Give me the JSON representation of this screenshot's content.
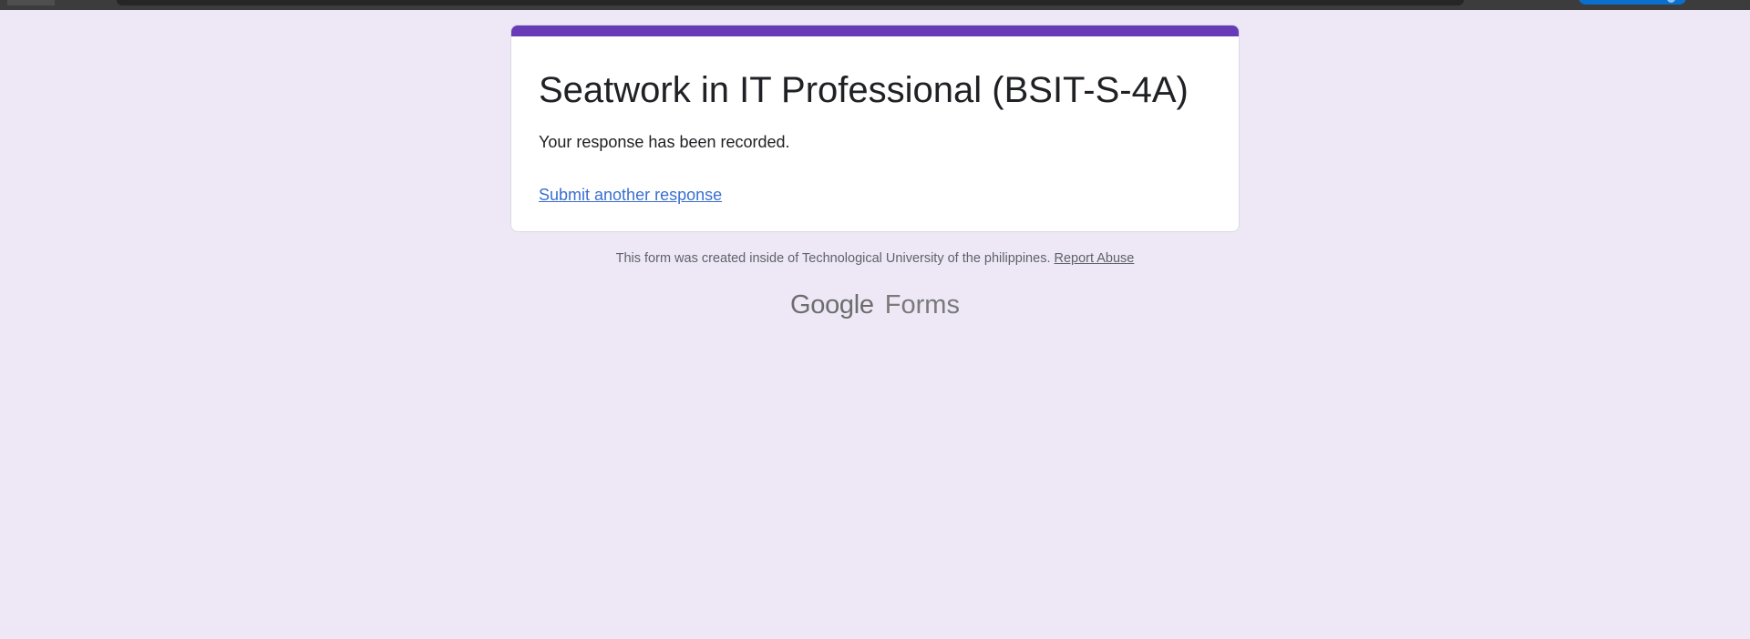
{
  "form": {
    "title": "Seatwork in IT Professional (BSIT-S-4A)",
    "confirmation_message": "Your response has been recorded.",
    "submit_another_label": "Submit another response",
    "accent_color": "#673ab7"
  },
  "footer": {
    "note": "This form was created inside of Technological University of the philippines.",
    "report_abuse_label": "Report Abuse"
  },
  "branding": {
    "google": "Google",
    "product": "Forms"
  },
  "colors": {
    "page_background": "#ede7f6",
    "link": "#3b6fd1",
    "browser_button": "#0b6fcf"
  }
}
